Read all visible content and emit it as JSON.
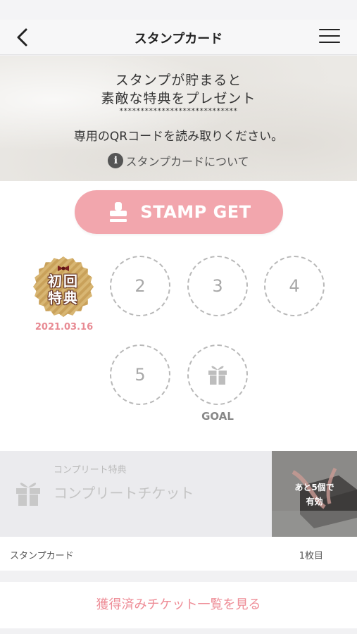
{
  "header": {
    "title": "スタンプカード"
  },
  "banner": {
    "line1": "スタンプが貯まると",
    "line2": "素敵な特典をプレゼント",
    "stars": "****************************",
    "line3": "専用のQRコードを読み取りください。",
    "info_link": "スタンプカードについて",
    "info_icon_glyph": "i"
  },
  "stamp_button": {
    "label": "STAMP GET",
    "color": "#f2a6ad"
  },
  "stamps": {
    "first": {
      "text_line1": "初回",
      "text_line2": "特典",
      "date": "2021.03.16",
      "color": "#c9a15a"
    },
    "slots": [
      "2",
      "3",
      "4",
      "5"
    ],
    "goal_label": "GOAL"
  },
  "complete": {
    "subtitle": "コンプリート特典",
    "title": "コンプリートチケット",
    "remaining_line1": "あと5個で",
    "remaining_line2": "有効"
  },
  "card_footer": {
    "left": "スタンプカード",
    "right": "1枚目"
  },
  "tickets_link": "獲得済みチケット一覧を見る",
  "accent_color": "#ee8d97"
}
